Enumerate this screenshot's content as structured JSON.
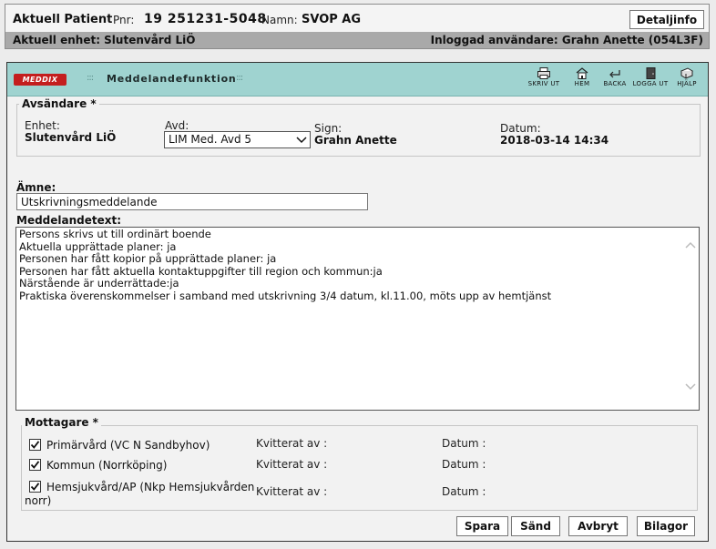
{
  "patient_header": {
    "title": "Aktuell Patient",
    "pnr_label": "Pnr:",
    "pnr_value": "19 251231-5048",
    "namn_label": "Namn:",
    "namn_value": "SVOP AG",
    "detaljinfo_label": "Detaljinfo",
    "unit_label": "Aktuell enhet: Slutenvård LiÖ",
    "user_label": "Inloggad användare: Grahn Anette (054L3F)"
  },
  "toolbar": {
    "logo_text": "MEDDIX",
    "grip": ":::",
    "title": "Meddelandefunktion",
    "buttons": [
      {
        "label": "SKRIV UT",
        "icon": "printer-icon"
      },
      {
        "label": "HEM",
        "icon": "home-icon"
      },
      {
        "label": "BACKA",
        "icon": "back-arrow-icon"
      },
      {
        "label": "LOGGA UT",
        "icon": "door-icon"
      },
      {
        "label": "HJÄLP",
        "icon": "book-icon"
      }
    ]
  },
  "sender": {
    "legend": "Avsändare *",
    "enhet_label": "Enhet:",
    "enhet_value": "Slutenvård LiÖ",
    "avd_label": "Avd:",
    "avd_selected": "LIM Med. Avd 5",
    "sign_label": "Sign:",
    "sign_value": "Grahn Anette",
    "datum_label": "Datum:",
    "datum_value": "2018-03-14 14:34"
  },
  "subject": {
    "label": "Ämne:",
    "value": "Utskrivningsmeddelande"
  },
  "message": {
    "label": "Meddelandetext:",
    "lines": [
      "Persons skrivs ut till ordinärt boende",
      "Aktuella upprättade planer: ja",
      "Personen har fått kopior på upprättade planer: ja",
      "Personen har fått aktuella kontaktuppgifter till region och kommun:ja",
      "Närstående är underrättade:ja",
      "Praktiska överenskommelser i samband med utskrivning 3/4 datum, kl.11.00, möts upp av hemtjänst"
    ]
  },
  "recipients": {
    "legend": "Mottagare *",
    "kvitterat_label": "Kvitterat av :",
    "datum_label": "Datum :",
    "items": [
      {
        "name": "Primärvård (VC N Sandbyhov)",
        "checked": true
      },
      {
        "name": "Kommun (Norrköping)",
        "checked": true
      },
      {
        "name_line1": "Hemsjukvård/AP (Nkp Hemsjukvården",
        "name_line2": "norr)",
        "checked": true
      }
    ]
  },
  "actions": {
    "spara": "Spara",
    "sand": "Sänd",
    "avbryt": "Avbryt",
    "bilagor": "Bilagor"
  }
}
